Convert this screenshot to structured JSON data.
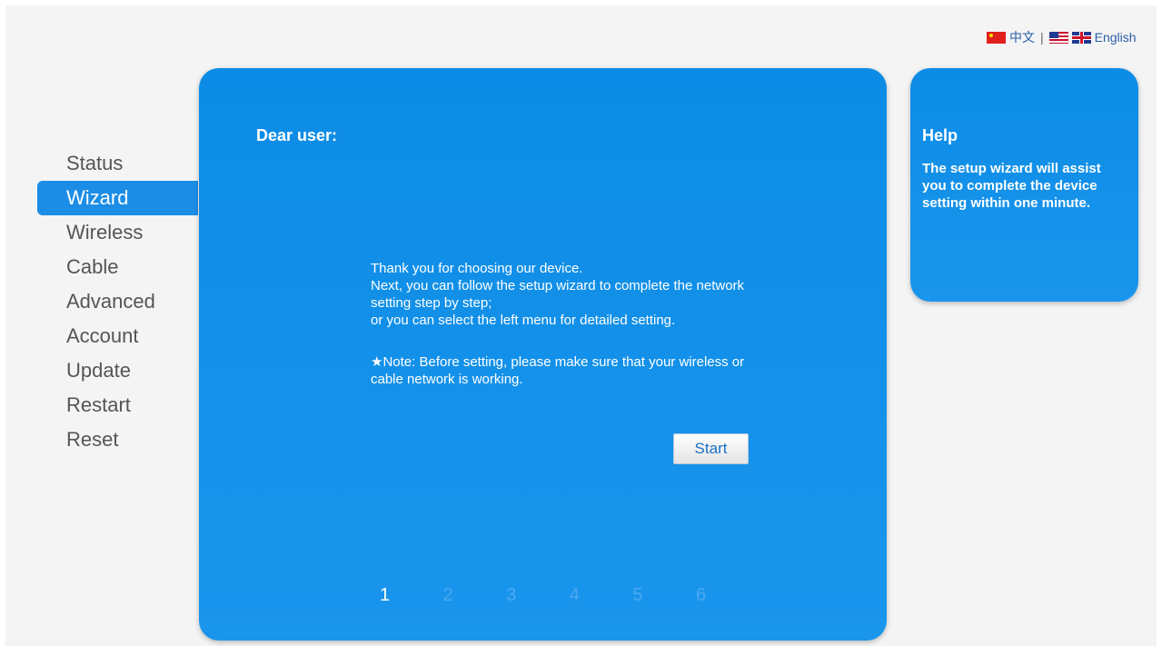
{
  "language": {
    "chinese_label": "中文",
    "separator": "|",
    "english_label": "English"
  },
  "sidebar": {
    "items": [
      {
        "label": "Status"
      },
      {
        "label": "Wizard"
      },
      {
        "label": "Wireless"
      },
      {
        "label": "Cable"
      },
      {
        "label": "Advanced"
      },
      {
        "label": "Account"
      },
      {
        "label": "Update"
      },
      {
        "label": "Restart"
      },
      {
        "label": "Reset"
      }
    ],
    "active": "Wizard"
  },
  "main": {
    "greeting": "Dear user:",
    "intro_lines": [
      "Thank you for choosing our device.",
      "Next, you can follow the setup wizard to complete the network setting step by step;",
      "or you can select the left menu for detailed setting."
    ],
    "note": "★Note: Before setting, please make sure that your wireless or cable network is working.",
    "start_label": "Start",
    "steps": [
      "1",
      "2",
      "3",
      "4",
      "5",
      "6"
    ],
    "current_step": "1"
  },
  "help": {
    "title": "Help",
    "text": "The setup wizard will assist you to complete the device setting within one minute."
  },
  "colors": {
    "panel_blue": "#0c8ce6",
    "active_menu": "#1b8de6",
    "inactive_step": "#4aa8f0"
  }
}
